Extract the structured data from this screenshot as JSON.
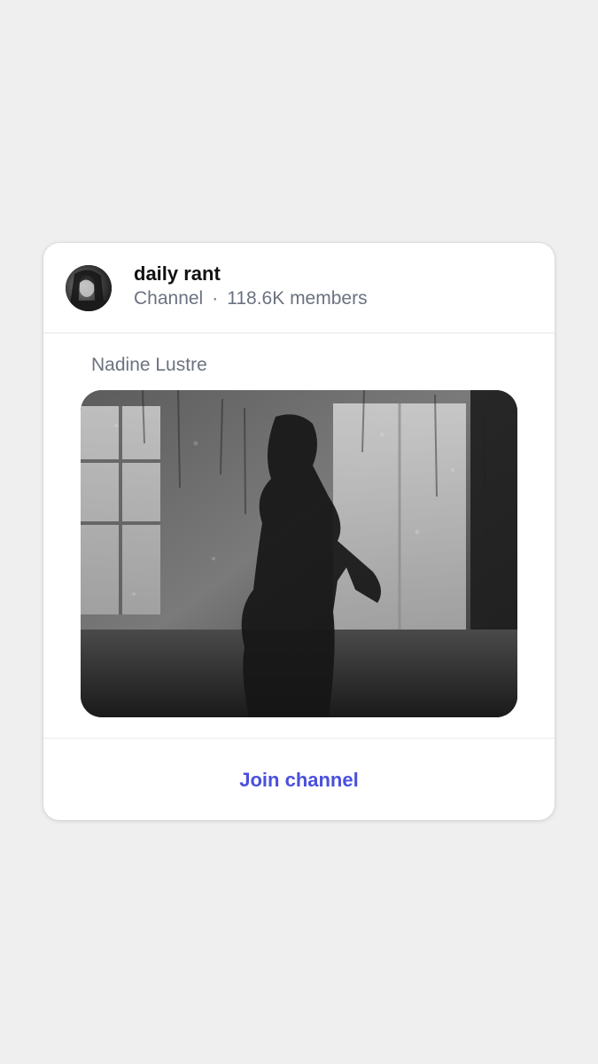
{
  "channel": {
    "name": "daily rant",
    "type_label": "Channel",
    "separator": "·",
    "members": "118.6K members"
  },
  "post": {
    "author": "Nadine Lustre",
    "image_icon": "photo-image"
  },
  "footer": {
    "join_label": "Join channel"
  },
  "colors": {
    "background": "#efefef",
    "card": "#ffffff",
    "accent": "#4a50dc",
    "muted_text": "#6b7280"
  }
}
